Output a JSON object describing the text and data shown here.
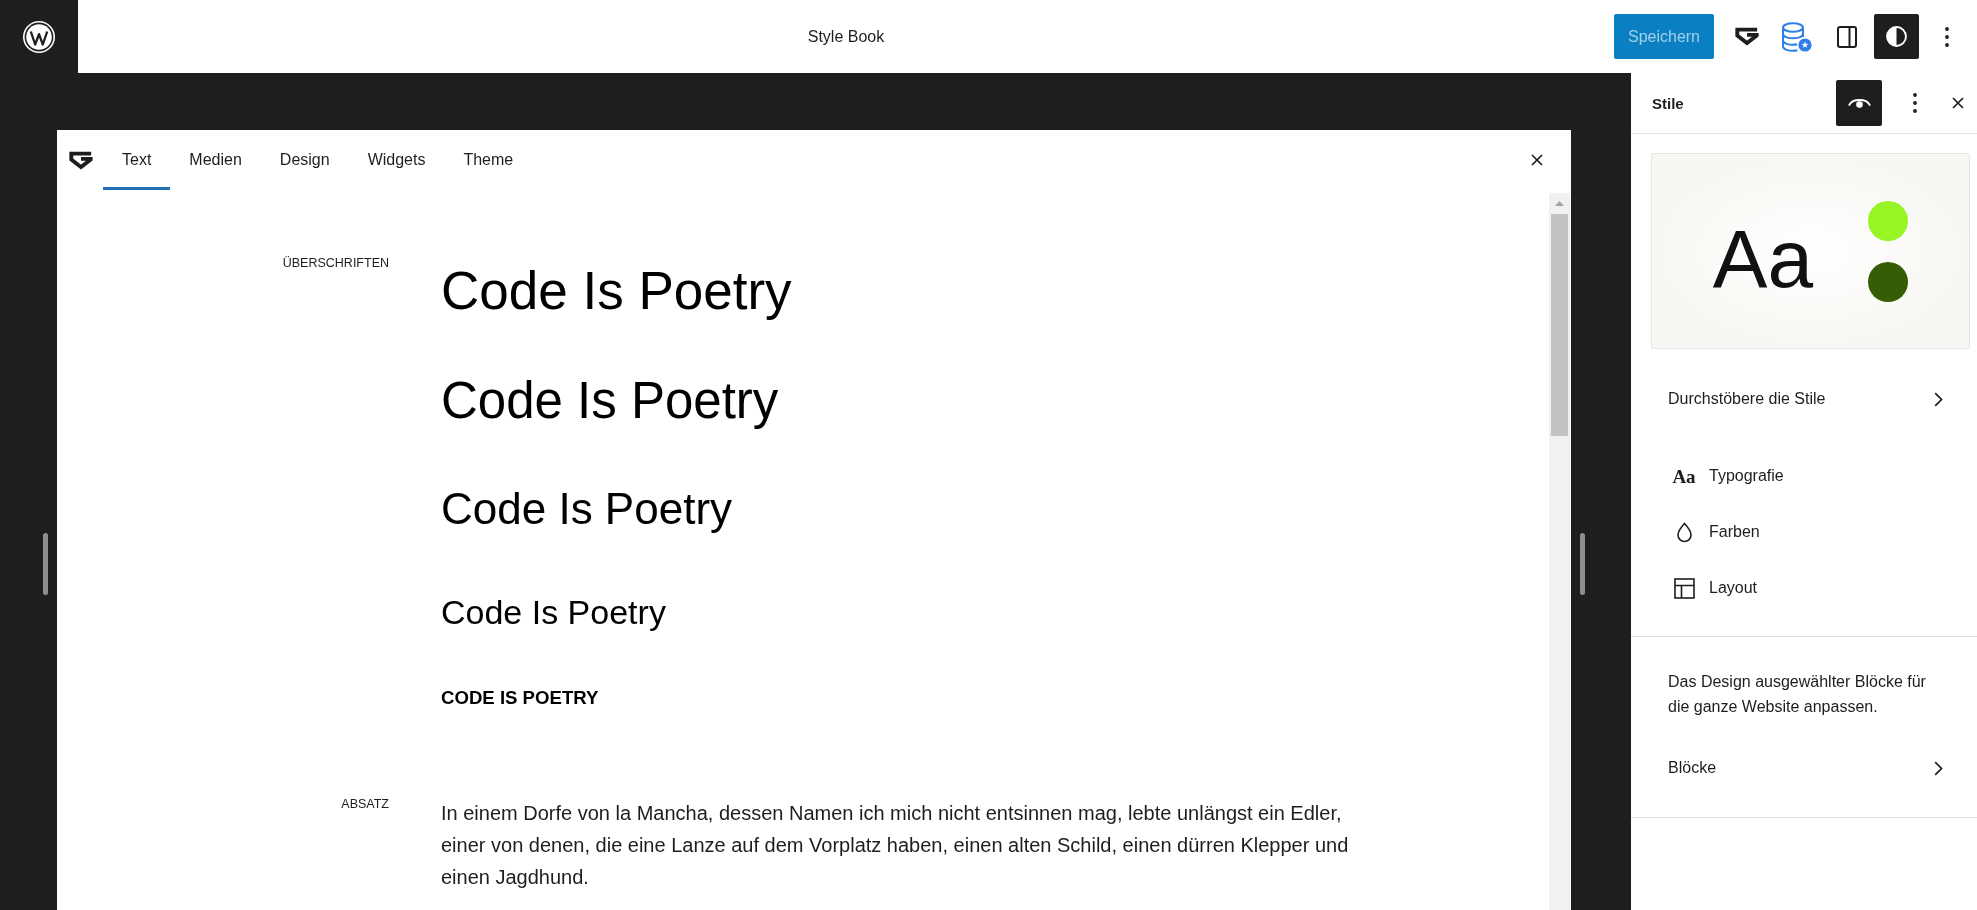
{
  "top_bar": {
    "title": "Style Book",
    "save_button": {
      "label": "Speichern",
      "disabled": true
    },
    "styles_button": {
      "pressed": true
    }
  },
  "style_book": {
    "tabs": [
      {
        "label": "Text",
        "selected": true
      },
      {
        "label": "Medien",
        "selected": false
      },
      {
        "label": "Design",
        "selected": false
      },
      {
        "label": "Widgets",
        "selected": false
      },
      {
        "label": "Theme",
        "selected": false
      }
    ],
    "sections": [
      {
        "label": "ÜBERSCHRIFTEN",
        "kind": "headings",
        "items": [
          {
            "kind": "h1",
            "text": "Code Is Poetry"
          },
          {
            "kind": "h2",
            "text": "Code Is Poetry"
          },
          {
            "kind": "h3",
            "text": "Code Is Poetry"
          },
          {
            "kind": "h4",
            "text": "Code Is Poetry"
          },
          {
            "kind": "h5",
            "text": "CODE IS POETRY"
          }
        ]
      },
      {
        "label": "ABSATZ",
        "kind": "paragraph",
        "text": "In einem Dorfe von la Mancha, dessen Namen ich mich nicht entsinnen mag, lebte unlängst ein Edler, einer von denen, die eine Lanze auf dem Vorplatz haben, einen alten Schild, einen dürren Klepper und einen Jagdhund."
      }
    ]
  },
  "sidebar": {
    "title": "Stile",
    "style_book_button": {
      "pressed": true
    },
    "preview": {
      "sample": "Aa",
      "swatches": [
        {
          "color": "#97f523"
        },
        {
          "color": "#365d06"
        }
      ]
    },
    "browse": {
      "label": "Durchstöbere die Stile"
    },
    "items": [
      {
        "kind": "typography",
        "glyph": "Aa",
        "label": "Typografie"
      },
      {
        "kind": "colors",
        "label": "Farben"
      },
      {
        "kind": "layout",
        "label": "Layout"
      }
    ],
    "blocks": {
      "description": "Das Design ausgewählter Blöcke für die ganze Website anpassen.",
      "label": "Blöcke"
    }
  }
}
